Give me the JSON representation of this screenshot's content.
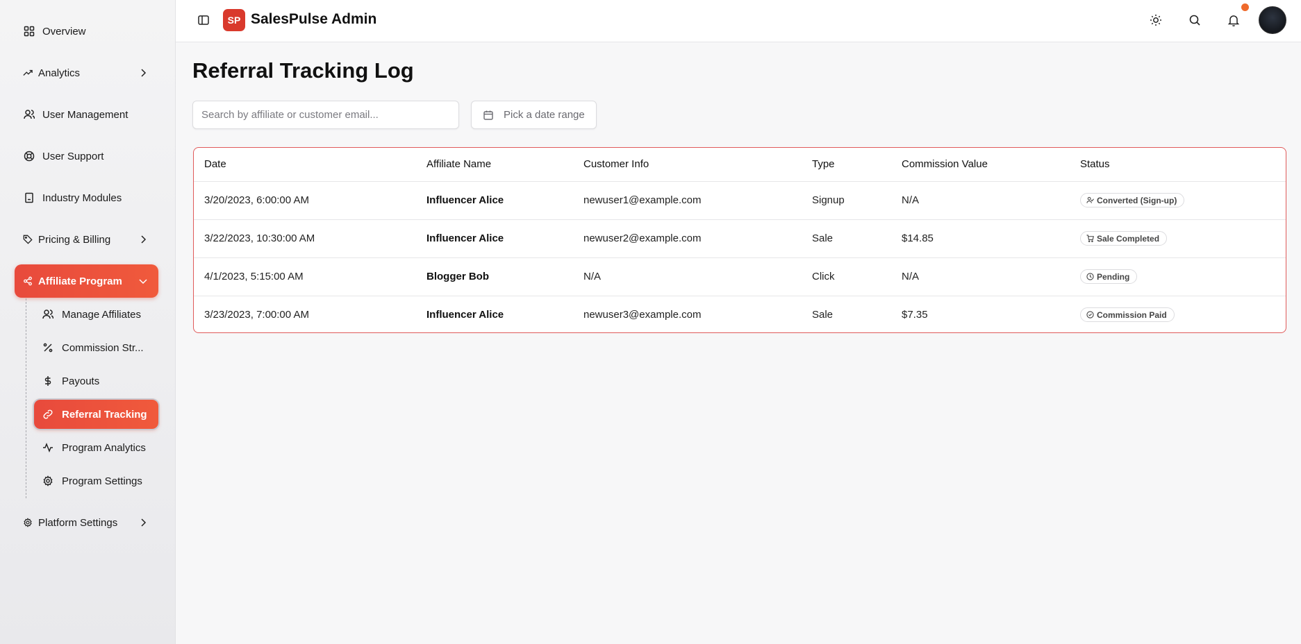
{
  "app": {
    "logo_initials": "SP",
    "title": "SalesPulse Admin"
  },
  "sidebar": {
    "items": [
      {
        "label": "Overview",
        "icon": "grid-icon"
      },
      {
        "label": "Analytics",
        "icon": "trending-up-icon"
      },
      {
        "label": "User Management",
        "icon": "users-icon"
      },
      {
        "label": "User Support",
        "icon": "lifebuoy-icon"
      },
      {
        "label": "Industry Modules",
        "icon": "building-icon"
      },
      {
        "label": "Pricing & Billing",
        "icon": "tag-icon"
      },
      {
        "label": "Affiliate Program",
        "icon": "share-icon"
      },
      {
        "label": "Platform Settings",
        "icon": "gear-icon"
      }
    ],
    "sub_items": [
      {
        "label": "Manage Affiliates",
        "icon": "users-icon"
      },
      {
        "label": "Commission Str...",
        "icon": "percent-icon"
      },
      {
        "label": "Payouts",
        "icon": "dollar-icon"
      },
      {
        "label": "Referral Tracking",
        "icon": "link-icon"
      },
      {
        "label": "Program Analytics",
        "icon": "activity-icon"
      },
      {
        "label": "Program Settings",
        "icon": "gear-icon"
      }
    ]
  },
  "page": {
    "title": "Referral Tracking Log"
  },
  "filters": {
    "search_placeholder": "Search by affiliate or customer email...",
    "date_placeholder": "Pick a date range"
  },
  "table": {
    "headers": [
      "Date",
      "Affiliate Name",
      "Customer Info",
      "Type",
      "Commission Value",
      "Status"
    ],
    "rows": [
      {
        "date": "3/20/2023, 6:00:00 AM",
        "affiliate": "Influencer Alice",
        "customer": "newuser1@example.com",
        "type": "Signup",
        "commission": "N/A",
        "status": "Converted (Sign-up)",
        "status_icon": "user-check-icon"
      },
      {
        "date": "3/22/2023, 10:30:00 AM",
        "affiliate": "Influencer Alice",
        "customer": "newuser2@example.com",
        "type": "Sale",
        "commission": "$14.85",
        "status": "Sale Completed",
        "status_icon": "cart-icon"
      },
      {
        "date": "4/1/2023, 5:15:00 AM",
        "affiliate": "Blogger Bob",
        "customer": "N/A",
        "type": "Click",
        "commission": "N/A",
        "status": "Pending",
        "status_icon": "clock-icon"
      },
      {
        "date": "3/23/2023, 7:00:00 AM",
        "affiliate": "Influencer Alice",
        "customer": "newuser3@example.com",
        "type": "Sale",
        "commission": "$7.35",
        "status": "Commission Paid",
        "status_icon": "check-circle-icon"
      }
    ]
  },
  "colors": {
    "accent": "#e84a3c",
    "notification": "#ef6a2c"
  }
}
